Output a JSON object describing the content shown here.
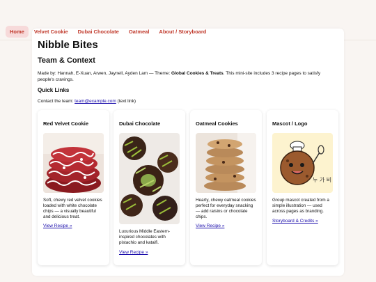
{
  "nav": {
    "items": [
      {
        "label": "Home",
        "active": true
      },
      {
        "label": "Velvet Cookie",
        "active": false
      },
      {
        "label": "Dubai Chocolate",
        "active": false
      },
      {
        "label": "Oatmeal",
        "active": false
      },
      {
        "label": "About / Storyboard",
        "active": false
      }
    ]
  },
  "site": {
    "title": "Nibble Bites"
  },
  "team": {
    "heading": "Team & Context",
    "made_prefix": "Made by: Hannah, E-Xuan, Arwen, Jaynell, Ayden Lam — Theme: ",
    "theme": "Global Cookies & Treats",
    "made_suffix": ". This mini-site includes 3 recipe pages to satisfy people's cravings."
  },
  "quick_links": {
    "heading": "Quick Links",
    "contact_prefix": "Contact the team: ",
    "email": "team@example.com",
    "contact_suffix": " (text link)"
  },
  "cards": [
    {
      "title": "Red Velvet Cookie",
      "desc": "Soft, chewy red velvet cookies loaded with white chocolate chips — a visually beautiful and delicious treat.",
      "link": "View Recipe »"
    },
    {
      "title": "Dubai Chocolate",
      "desc": "Luxurious Middle Eastern-inspired chocolates with pistachio and kataifi.",
      "link": "View Recipe »"
    },
    {
      "title": "Oatmeal Cookies",
      "desc": "Hearty, chewy oatmeal cookies perfect for everyday snacking — add raisins or chocolate chips.",
      "link": "View Recipe »"
    },
    {
      "title": "Mascot / Logo",
      "desc": "Group mascot created from a simple illustration — used across pages as branding.",
      "link": "Storyboard & Credits »"
    }
  ],
  "colors": {
    "nav_text": "#c0392b",
    "nav_active_bg": "#f7dada",
    "link": "#1a0dab",
    "page_bg": "#f9f5f2"
  }
}
